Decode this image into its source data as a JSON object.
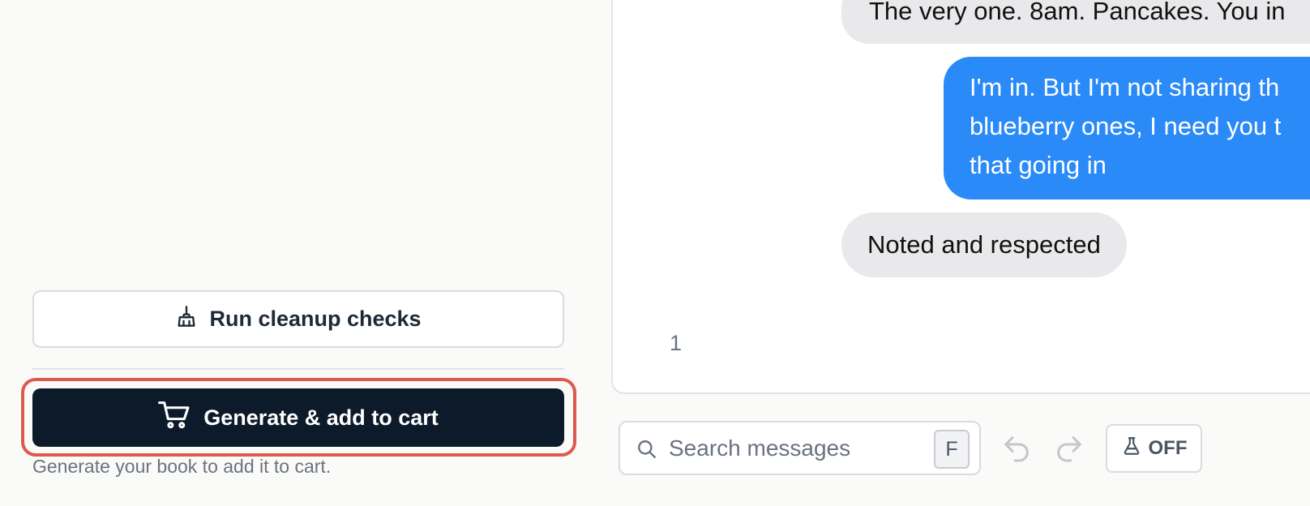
{
  "sidebar": {
    "cleanup_label": "Run cleanup checks",
    "cleanup_icon": "broom-icon",
    "generate_label": "Generate & add to cart",
    "generate_icon": "cart-icon",
    "helper_text": "Generate your book to add it to cart.",
    "highlight_color": "#dc5a4e",
    "primary_color": "#0c1a2a"
  },
  "chat": {
    "messages": [
      {
        "direction": "incoming",
        "text": "The very one. 8am. Pancakes. You in"
      },
      {
        "direction": "outgoing",
        "lines": [
          "I'm in. But I'm not sharing th",
          "blueberry ones, I need you t",
          "that going in"
        ]
      },
      {
        "direction": "incoming",
        "text": "Noted and respected"
      }
    ],
    "page_number": "1",
    "incoming_color": "#e9e9eb",
    "outgoing_color": "#2a8af7"
  },
  "toolbar": {
    "search_placeholder": "Search messages",
    "search_value": "",
    "shortcut_key": "F",
    "toggle_label": "OFF",
    "toggle_icon": "flask-icon"
  }
}
